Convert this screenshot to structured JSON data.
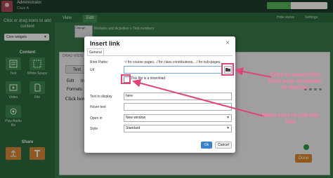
{
  "header": {
    "user_name": "Administrator",
    "user_class": "Class A",
    "progress_text": "40%",
    "progress_value": 0.4
  },
  "sidebar": {
    "hint": "Click or drag icons to add content",
    "widget_select": "Core widgets",
    "content_heading": "Content",
    "tools": [
      "Text",
      "White Space",
      "Video",
      "File",
      "Play Audio file"
    ],
    "share_heading": "Share"
  },
  "tabs": {
    "view": "View",
    "edit": "Edit",
    "hide_status": "Hide status",
    "settings": "Settings"
  },
  "editor": {
    "thumb_label": "Change",
    "crumb": "Modules and Activities > Text numbers",
    "panel_head": "DRAG WIDG",
    "text_button": "Text",
    "edit_menu": "Edit",
    "insert_menu": "Ins",
    "formats_menu": "Formats",
    "body_text": "Click here t",
    "done_button": "Done"
  },
  "dialog": {
    "title": "Insert link",
    "close": "×",
    "tab_general": "General",
    "root_paths_label": "Root Paths:",
    "root_paths_text": "~/ for course pages, ./ for class contributions, ../ for sub-pages.",
    "url_label": "Url",
    "url_value": "",
    "checkbox_label": "This file is a download",
    "text_to_display_label": "Text to display",
    "text_to_display_value": "here",
    "hover_text_label": "Hover text",
    "hover_text_value": "",
    "open_in_label": "Open in",
    "open_in_value": "New window",
    "style_label": "Style",
    "style_value": "Standard",
    "ok": "Ok",
    "cancel": "Cancel"
  },
  "annotations": {
    "search_callout": "Click to search file from your computer or device.",
    "tick_callout": "Make sure to tick this box"
  },
  "colors": {
    "sidebar_green": "#2d6a3c",
    "annotation_pink": "#e0447a",
    "ok_blue": "#3b7fd1",
    "done_orange": "#e0872a"
  }
}
